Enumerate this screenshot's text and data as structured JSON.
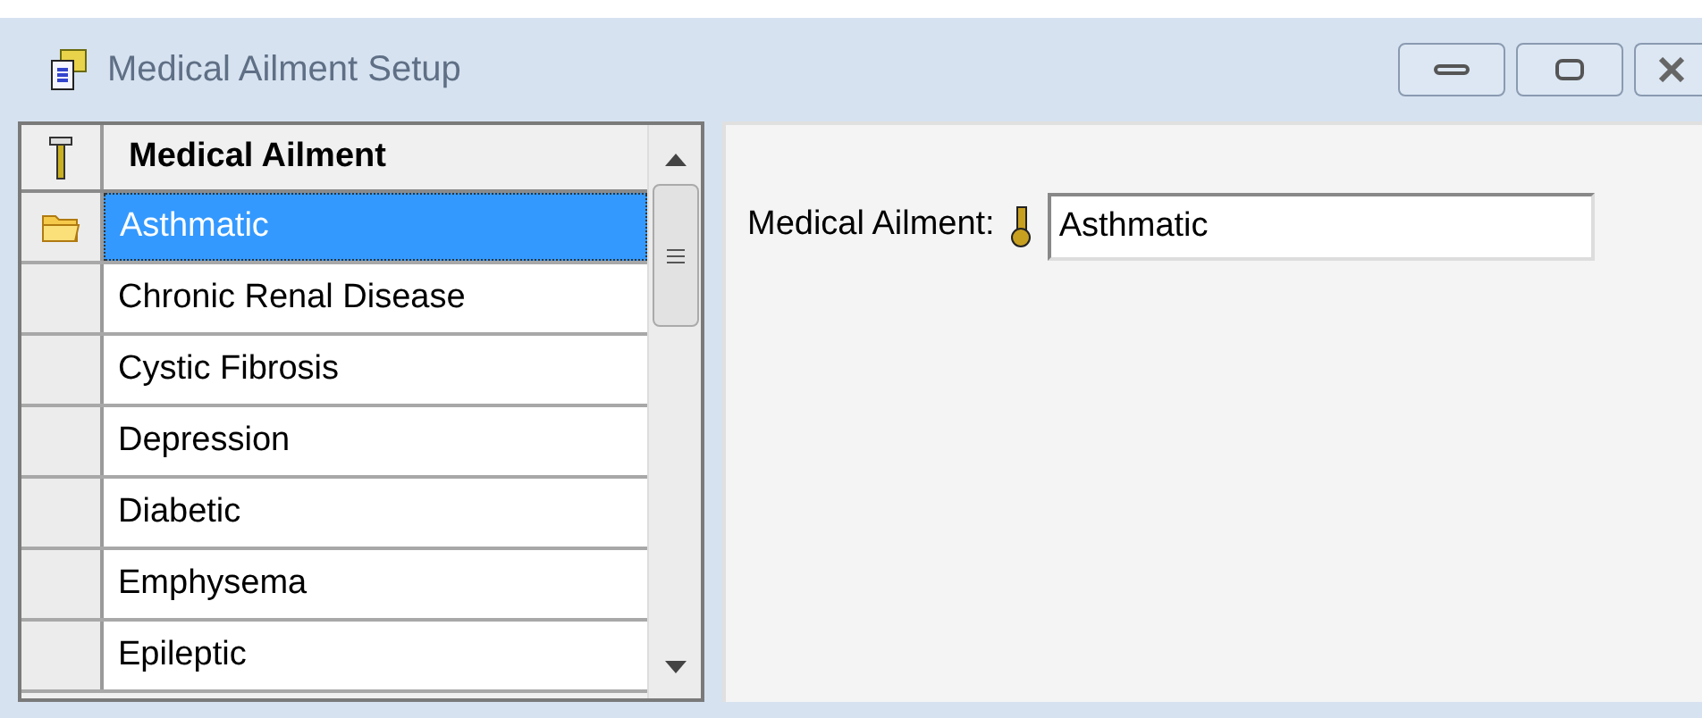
{
  "window": {
    "title": "Medical Ailment Setup"
  },
  "grid": {
    "columns": [
      "Medical Ailment"
    ],
    "rows": [
      {
        "name": "Asthmatic",
        "selected": true
      },
      {
        "name": "Chronic Renal Disease",
        "selected": false
      },
      {
        "name": "Cystic Fibrosis",
        "selected": false
      },
      {
        "name": "Depression",
        "selected": false
      },
      {
        "name": "Diabetic",
        "selected": false
      },
      {
        "name": "Emphysema",
        "selected": false
      },
      {
        "name": "Epileptic",
        "selected": false
      }
    ]
  },
  "detail": {
    "label": "Medical Ailment:",
    "value": "Asthmatic"
  }
}
